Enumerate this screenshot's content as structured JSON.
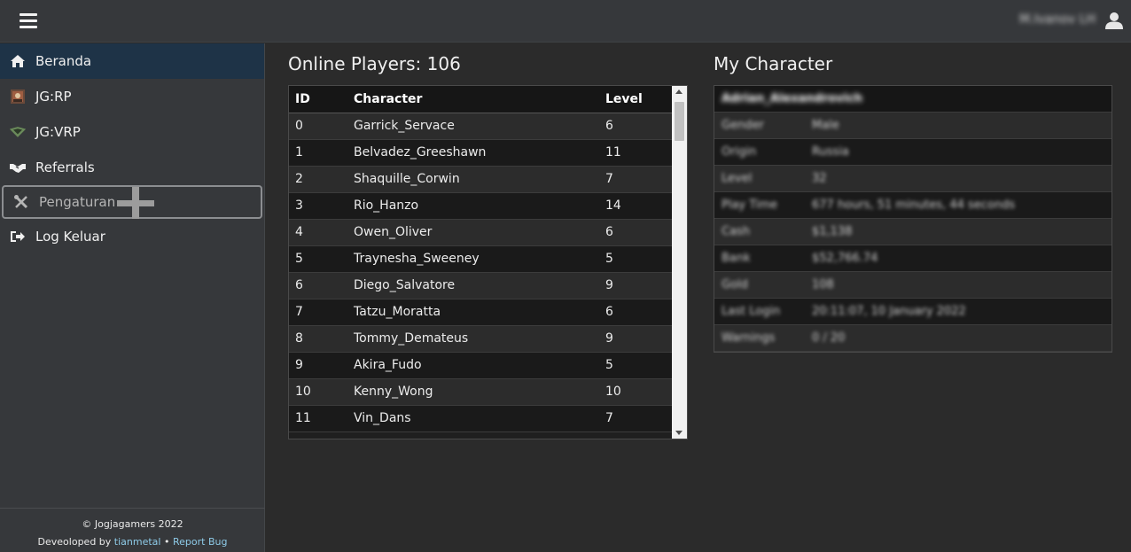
{
  "header": {
    "user_name": "M.Ivanov LH"
  },
  "sidebar": {
    "items": [
      {
        "label": "Beranda",
        "icon": "home-icon"
      },
      {
        "label": "JG:RP",
        "icon": "jgrp-logo-icon"
      },
      {
        "label": "JG:VRP",
        "icon": "jgvrp-logo-icon"
      },
      {
        "label": "Referrals",
        "icon": "handshake-icon"
      },
      {
        "label": "Pengaturan",
        "icon": "wrench-screwdriver-icon"
      },
      {
        "label": "Log Keluar",
        "icon": "sign-out-icon"
      }
    ],
    "footer": {
      "copyright": "© Jogjagamers 2022",
      "developed_prefix": "Deveoloped by",
      "developer": "tianmetal",
      "separator": "•",
      "report_bug": "Report Bug"
    }
  },
  "players": {
    "title": "Online Players: 106",
    "headers": [
      "ID",
      "Character",
      "Level"
    ],
    "rows": [
      [
        "0",
        "Garrick_Servace",
        "6"
      ],
      [
        "1",
        "Belvadez_Greeshawn",
        "11"
      ],
      [
        "2",
        "Shaquille_Corwin",
        "7"
      ],
      [
        "3",
        "Rio_Hanzo",
        "14"
      ],
      [
        "4",
        "Owen_Oliver",
        "6"
      ],
      [
        "5",
        "Traynesha_Sweeney",
        "5"
      ],
      [
        "6",
        "Diego_Salvatore",
        "9"
      ],
      [
        "7",
        "Tatzu_Moratta",
        "6"
      ],
      [
        "8",
        "Tommy_Demateus",
        "9"
      ],
      [
        "9",
        "Akira_Fudo",
        "5"
      ],
      [
        "10",
        "Kenny_Wong",
        "10"
      ],
      [
        "11",
        "Vin_Dans",
        "7"
      ]
    ]
  },
  "character": {
    "title": "My Character",
    "name": "Adrian_Alexandrovich",
    "rows": [
      {
        "label": "Gender",
        "value": "Male"
      },
      {
        "label": "Origin",
        "value": "Russia"
      },
      {
        "label": "Level",
        "value": "32"
      },
      {
        "label": "Play Time",
        "value": "677 hours, 51 minutes, 44 seconds"
      },
      {
        "label": "Cash",
        "value": "$1,138"
      },
      {
        "label": "Bank",
        "value": "$52,766.74"
      },
      {
        "label": "Gold",
        "value": "108"
      },
      {
        "label": "Last Login",
        "value": "20:11:07, 10 January 2022"
      },
      {
        "label": "Warnings",
        "value": "0 / 20"
      }
    ]
  }
}
